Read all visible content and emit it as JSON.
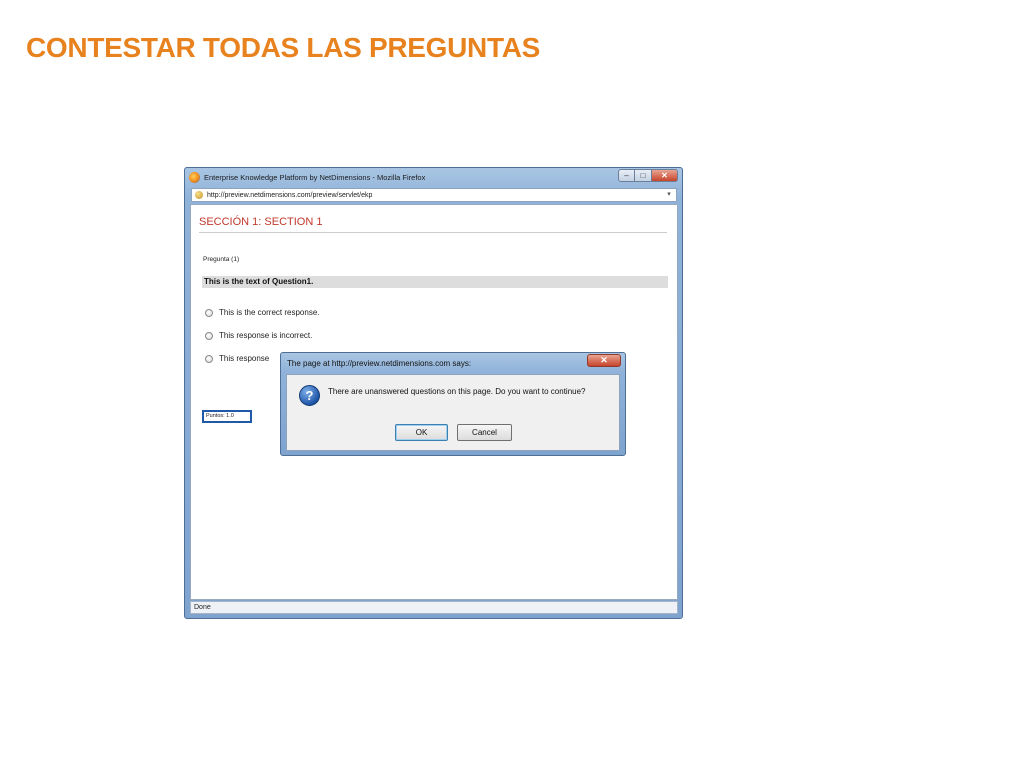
{
  "slide": {
    "title": "CONTESTAR TODAS LAS PREGUNTAS",
    "title_color": "#e8821e"
  },
  "browser": {
    "window_title": "Enterprise Knowledge Platform by NetDimensions - Mozilla Firefox",
    "minimize_glyph": "–",
    "maximize_glyph": "□",
    "close_glyph": "✕",
    "address_url": "http://preview.netdimensions.com/preview/servlet/ekp",
    "address_go_glyph": "▾",
    "status_text": "Done"
  },
  "page": {
    "section_heading": "SECCIÓN 1: SECTION 1",
    "section_heading_color": "#c0392b",
    "question_number": "Pregunta (1)",
    "question_text": "This is the text of Question1.",
    "options": [
      {
        "label": "This is the correct response."
      },
      {
        "label": "This response is incorrect."
      },
      {
        "label": "This response"
      }
    ],
    "score_label": "Puntos: 1.0"
  },
  "dialog": {
    "title": "The page at http://preview.netdimensions.com says:",
    "close_glyph": "✕",
    "icon_glyph": "?",
    "message": "There are unanswered questions on this page. Do you want to continue?",
    "ok_label": "OK",
    "cancel_label": "Cancel"
  }
}
